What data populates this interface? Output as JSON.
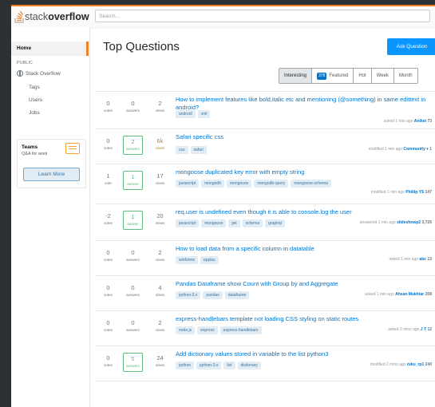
{
  "header": {
    "logo_stack": "stack",
    "logo_bold": "overflow",
    "search_placeholder": "Search..."
  },
  "sidebar": {
    "home": "Home",
    "public": "PUBLIC",
    "stack_overflow": "Stack Overflow",
    "tags": "Tags",
    "users": "Users",
    "jobs": "Jobs",
    "teams_title": "Teams",
    "teams_sub": "Q&A for work",
    "learn_more": "Learn More"
  },
  "main": {
    "title": "Top Questions",
    "ask_button": "Ask Question",
    "filters": {
      "interesting": "Interesting",
      "featured_count": "378",
      "featured": "Featured",
      "hot": "Hot",
      "week": "Week",
      "month": "Month"
    }
  },
  "questions": [
    {
      "votes": "0",
      "votes_label": "votes",
      "answers": "0",
      "answers_label": "answers",
      "views": "2",
      "views_label": "views",
      "title": "How to implement features like bold,italic etc and mentioning (@something) in same edittext in android?",
      "tags": [
        "android",
        "xml"
      ],
      "meta_text": "asked 1 min ago",
      "user": "Aniket",
      "rep": "73"
    },
    {
      "votes": "0",
      "votes_label": "votes",
      "answers": "2",
      "answers_label": "answers",
      "views": "6k",
      "views_label": "views",
      "title": "Safari specific css",
      "tags": [
        "css",
        "safari"
      ],
      "meta_text": "modified 1 min ago",
      "user": "Community",
      "rep": "♦ 1"
    },
    {
      "votes": "1",
      "votes_label": "vote",
      "answers": "1",
      "answers_label": "answer",
      "views": "17",
      "views_label": "views",
      "title": "mongoose duplicated key error with empty string",
      "tags": [
        "javascript",
        "mongodb",
        "mongoose",
        "mongodb-query",
        "mongoose-schema"
      ],
      "meta_text": "modified 1 min ago",
      "user": "Phillip YS",
      "rep": "147"
    },
    {
      "votes": "-2",
      "votes_label": "votes",
      "answers": "1",
      "answers_label": "answer",
      "views": "20",
      "views_label": "views",
      "title": "req.user is undefined even though it is able to console.log the user",
      "tags": [
        "javascript",
        "mongoose",
        "jwt",
        "schema",
        "graphql"
      ],
      "meta_text": "answered 1 min ago",
      "user": "slideshowp2",
      "rep": "3,726"
    },
    {
      "votes": "0",
      "votes_label": "votes",
      "answers": "0",
      "answers_label": "answers",
      "views": "2",
      "views_label": "views",
      "title": "How to load data from a specific column in datatable",
      "tags": [
        "winforms",
        "epplus"
      ],
      "meta_text": "asked 1 min ago",
      "user": "abc",
      "rep": "13"
    },
    {
      "votes": "0",
      "votes_label": "votes",
      "answers": "0",
      "answers_label": "answers",
      "views": "4",
      "views_label": "views",
      "title": "Pandas Dataframe show Count with Group by and Aggregate",
      "tags": [
        "python-3.x",
        "pandas",
        "dataframe"
      ],
      "meta_text": "asked 1 min ago",
      "user": "Ahsan Mukhtar",
      "rep": "208"
    },
    {
      "votes": "0",
      "votes_label": "votes",
      "answers": "0",
      "answers_label": "answers",
      "views": "2",
      "views_label": "views",
      "title": "express-handlebars template not loading CSS styling on static routes",
      "tags": [
        "node.js",
        "express",
        "express-handlebars"
      ],
      "meta_text": "asked 2 mins ago",
      "user": "J T",
      "rep": "12"
    },
    {
      "votes": "0",
      "votes_label": "votes",
      "answers": "5",
      "answers_label": "answers",
      "views": "24",
      "views_label": "views",
      "title": "Add dictionary values stored in variable to the list python3",
      "tags": [
        "python",
        "python-3.x",
        "list",
        "dictionary"
      ],
      "meta_text": "modified 2 mins ago",
      "user": "ruku_rp1",
      "rep": "240"
    }
  ]
}
